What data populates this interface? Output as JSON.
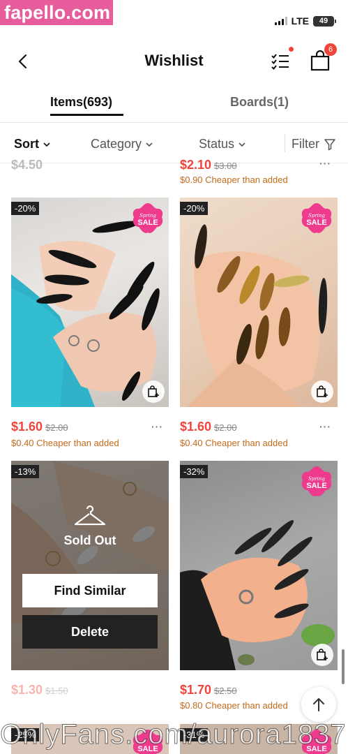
{
  "status_bar": {
    "watermark_badge": "fapello.com",
    "network": "LTE",
    "battery": "49"
  },
  "header": {
    "title": "Wishlist",
    "cart_count": "6"
  },
  "tabs": [
    {
      "label": "Items(693)",
      "active": true
    },
    {
      "label": "Boards(1)",
      "active": false
    }
  ],
  "filters": {
    "sort": "Sort",
    "category": "Category",
    "status": "Status",
    "filter": "Filter"
  },
  "partial_top": {
    "left_price": "$4.50",
    "right_price": "$2.10",
    "right_orig": "$3.00",
    "right_cheaper": "$0.90 Cheaper than added"
  },
  "products": [
    {
      "discount": "-20%",
      "price": "$1.60",
      "orig": "$2.00",
      "cheaper": "$0.40 Cheaper than added",
      "sale_badge": "SALE",
      "sale_script": "Spring"
    },
    {
      "discount": "-20%",
      "price": "$1.60",
      "orig": "$2.00",
      "cheaper": "$0.40 Cheaper than added",
      "sale_badge": "SALE",
      "sale_script": "Spring"
    },
    {
      "discount": "-13%",
      "price": "$1.30",
      "orig": "$1.50",
      "sold_out": "Sold Out",
      "find_similar": "Find Similar",
      "delete": "Delete"
    },
    {
      "discount": "-32%",
      "price": "$1.70",
      "orig": "$2.50",
      "cheaper": "$0.80 Cheaper than added",
      "sale_badge": "SALE",
      "sale_script": "Spring"
    }
  ],
  "partial_bottom": {
    "left_discount": "-25%",
    "right_discount": "-31%",
    "sale_badge": "SALE"
  },
  "overlay_watermark": "OnlyFans.com/aurora1837",
  "more": "···"
}
